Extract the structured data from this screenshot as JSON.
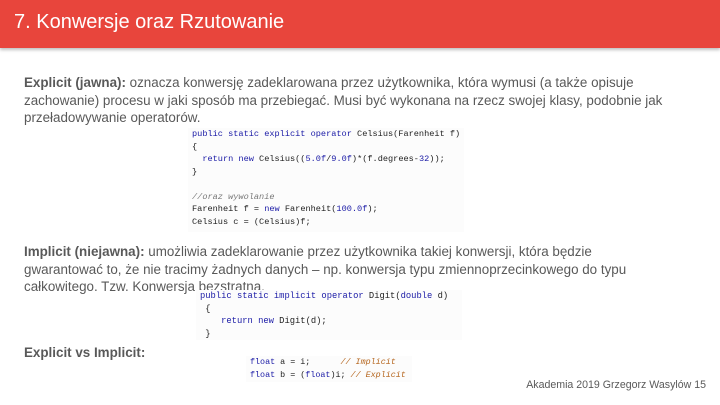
{
  "slide": {
    "title": "7. Konwersje oraz Rzutowanie",
    "explicit": {
      "term": "Explicit (jawna):",
      "text": " oznacza konwersję zadeklarowana przez użytkownika, która wymusi (a także opisuje zachowanie) procesu w jaki sposób ma przebiegać. Musi być wykonana na rzecz swojej klasy, podobnie jak przeładowywanie operatorów."
    },
    "explicit_code": {
      "l1_kw": "public static explicit operator",
      "l1_rest": " Celsius(Farenheit f)",
      "l2": "{",
      "l3_kw": "  return new",
      "l3_a": " Celsius((",
      "l3_n1": "5.0f",
      "l3_b": "/",
      "l3_n2": "9.0f",
      "l3_c": ")*(f.degrees-",
      "l3_n3": "32",
      "l3_d": "));",
      "l4": "}",
      "l5_comment": "//oraz wywolanie",
      "l6_a": "Farenheit f = ",
      "l6_kw": "new",
      "l6_b": " Farenheit(",
      "l6_n": "100.0f",
      "l6_c": ");",
      "l7": "Celsius c = (Celsius)f;"
    },
    "implicit": {
      "term": "Implicit (niejawna):",
      "text": " umożliwia zadeklarowanie przez użytkownika takiej konwersji, która będzie gwarantować to, że nie tracimy żadnych danych – np. konwersja typu zmiennoprzecinkowego do typu całkowitego. Tzw. Konwersja bezstratna."
    },
    "implicit_code": {
      "l1_kw": "public static implicit operator",
      "l1_a": " Digit(",
      "l1_kw2": "double",
      "l1_b": " d)",
      "l2": "{",
      "l3_kw": "    return new",
      "l3_rest": " Digit(d);",
      "l4": "}"
    },
    "vs_heading": "Explicit vs Implicit:",
    "vs_code": {
      "l1_kw": "float",
      "l1_a": " a = i;      ",
      "l1_cm": "// Implicit",
      "l2_kw": "float",
      "l2_a": " b = (",
      "l2_kw2": "float",
      "l2_b": ")i; ",
      "l2_cm": "// Explicit"
    },
    "footer": "Akademia 2019 Grzegorz Wasylów 15"
  }
}
